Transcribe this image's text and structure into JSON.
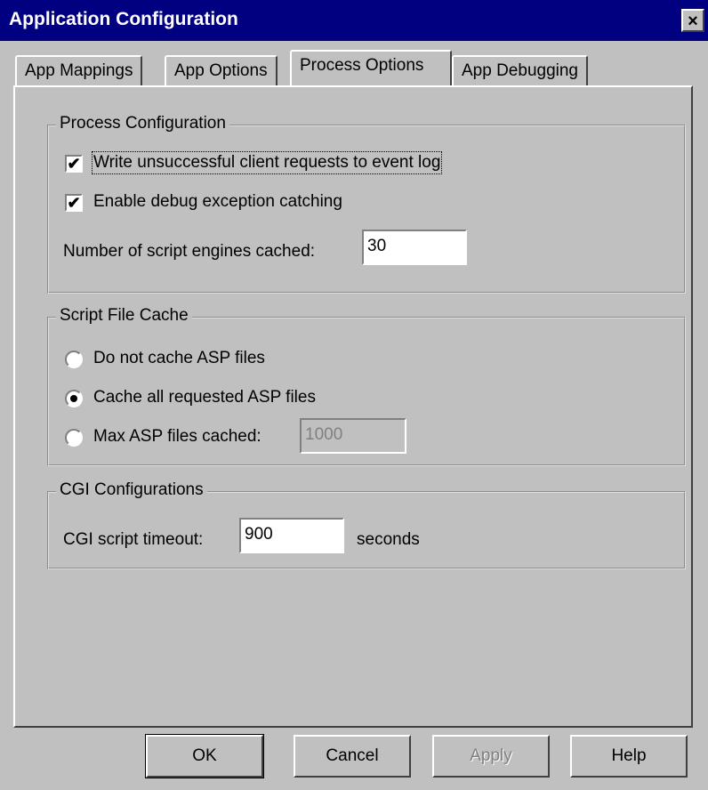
{
  "window": {
    "title": "Application Configuration",
    "close_label": "×"
  },
  "tabs": [
    {
      "label": "App Mappings",
      "active": false
    },
    {
      "label": "App Options",
      "active": false
    },
    {
      "label": "Process Options",
      "active": true
    },
    {
      "label": "App Debugging",
      "active": false
    }
  ],
  "process_configuration": {
    "legend": "Process Configuration",
    "write_log_label": "Write unsuccessful client requests to event log",
    "write_log_checked": true,
    "debug_label": "Enable debug exception catching",
    "debug_checked": true,
    "engines_label": "Number of script engines cached:",
    "engines_value": "30",
    "check_mark": "✔"
  },
  "script_file_cache": {
    "legend": "Script File Cache",
    "options": [
      {
        "label": "Do not cache ASP files",
        "selected": false
      },
      {
        "label": "Cache all requested ASP files",
        "selected": true
      },
      {
        "label": "Max ASP files cached:",
        "selected": false
      }
    ],
    "max_value": "1000"
  },
  "cgi_configurations": {
    "legend": "CGI Configurations",
    "timeout_label": "CGI script timeout:",
    "timeout_value": "900",
    "unit": "seconds"
  },
  "buttons": {
    "ok": "OK",
    "cancel": "Cancel",
    "apply": "Apply",
    "help": "Help"
  }
}
